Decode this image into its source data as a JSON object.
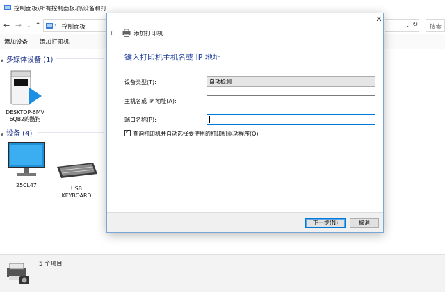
{
  "window": {
    "breadcrumb_path": "控制面板\\所有控制面板项\\设备和打",
    "address_crumb": "控制面板",
    "search_placeholder": "搜索"
  },
  "toolbar": {
    "add_device": "添加设备",
    "add_printer": "添加打印机"
  },
  "groups": {
    "multimedia": "多媒体设备 (1)",
    "devices": "设备 (4)"
  },
  "devices": {
    "media_server": "DESKTOP-6MV\n6QB2的酷狗",
    "monitor": "25CL47",
    "keyboard": "USB\nKEYBOARD"
  },
  "status": {
    "item_count": "5 个项目"
  },
  "dialog": {
    "title": "添加打印机",
    "heading": "键入打印机主机名或 IP 地址",
    "device_type_label": "设备类型(T):",
    "device_type_value": "自动检测",
    "hostname_label": "主机名或 IP 地址(A):",
    "hostname_value": "",
    "port_label": "端口名称(P):",
    "port_value": "",
    "query_checkbox_label": "查询打印机并自动选择要使用的打印机驱动程序(Q)",
    "query_checked": true,
    "next_button": "下一步(N)",
    "cancel_button": "取消"
  },
  "colors": {
    "accent": "#0078d7",
    "heading": "#1d3f9e",
    "group_header": "#1e3287"
  }
}
